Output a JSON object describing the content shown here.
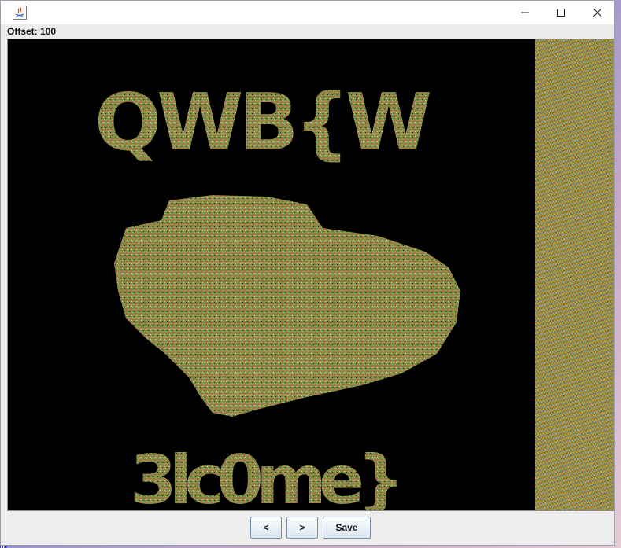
{
  "window": {
    "title": "",
    "controls": {
      "minimize_icon": "minimize-icon",
      "maximize_icon": "maximize-icon",
      "close_icon": "close-icon"
    }
  },
  "status": {
    "offset_label": "Offset: 100"
  },
  "canvas": {
    "top_text": "QWB{W",
    "bottom_text": "3lc0me}",
    "noise_color": "#8a8a48",
    "background": "#000000"
  },
  "buttons": {
    "prev_label": "<",
    "next_label": ">",
    "save_label": "Save"
  }
}
